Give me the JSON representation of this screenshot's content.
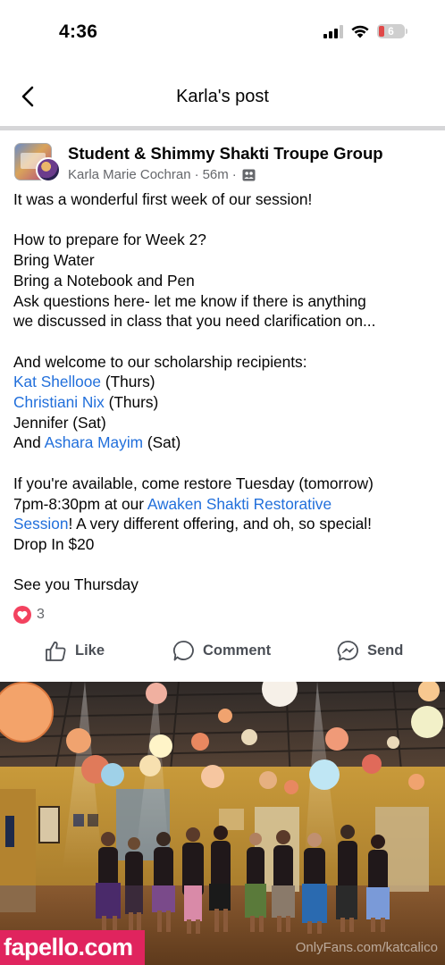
{
  "status_bar": {
    "time": "4:36",
    "battery": "6"
  },
  "nav": {
    "title": "Karla's post"
  },
  "post": {
    "group_name": "Student & Shimmy Shakti Troupe Group",
    "author": "Karla Marie Cochran",
    "time_ago": "56m",
    "separator": "·",
    "lines": {
      "l1": "It was a wonderful first week of our session!",
      "l2": "How to prepare for Week 2?",
      "l3": "Bring Water",
      "l4": "Bring a Notebook and Pen",
      "l5": "Ask questions here- let me know if there is anything",
      "l6": "we discussed in class that you need clarification on...",
      "l7": "And welcome to our scholarship recipients:",
      "r1_name": "Kat Shellooe",
      "r1_day": " (Thurs)",
      "r2_name": "Christiani Nix",
      "r2_day": " (Thurs)",
      "r3": "Jennifer (Sat)",
      "r4_prefix": "And ",
      "r4_name": "Ashara Mayim",
      "r4_day": " (Sat)",
      "l8": "If you're available, come restore Tuesday (tomorrow)",
      "l9_prefix": "7pm-8:30pm at our ",
      "l9_link": "Awaken Shakti Restorative",
      "l10_link": "Session",
      "l10_suffix": "! A very different offering, and oh, so special!",
      "l11": "Drop In $20",
      "l12": "See you Thursday"
    },
    "reaction_count": "3"
  },
  "actions": {
    "like": "Like",
    "comment": "Comment",
    "send": "Send"
  },
  "watermarks": {
    "left": "fapello.com",
    "right": "OnlyFans.com/katcalico"
  },
  "colors": {
    "link": "#216fdb",
    "heart": "#f3425f",
    "battery_low": "#e04848"
  }
}
